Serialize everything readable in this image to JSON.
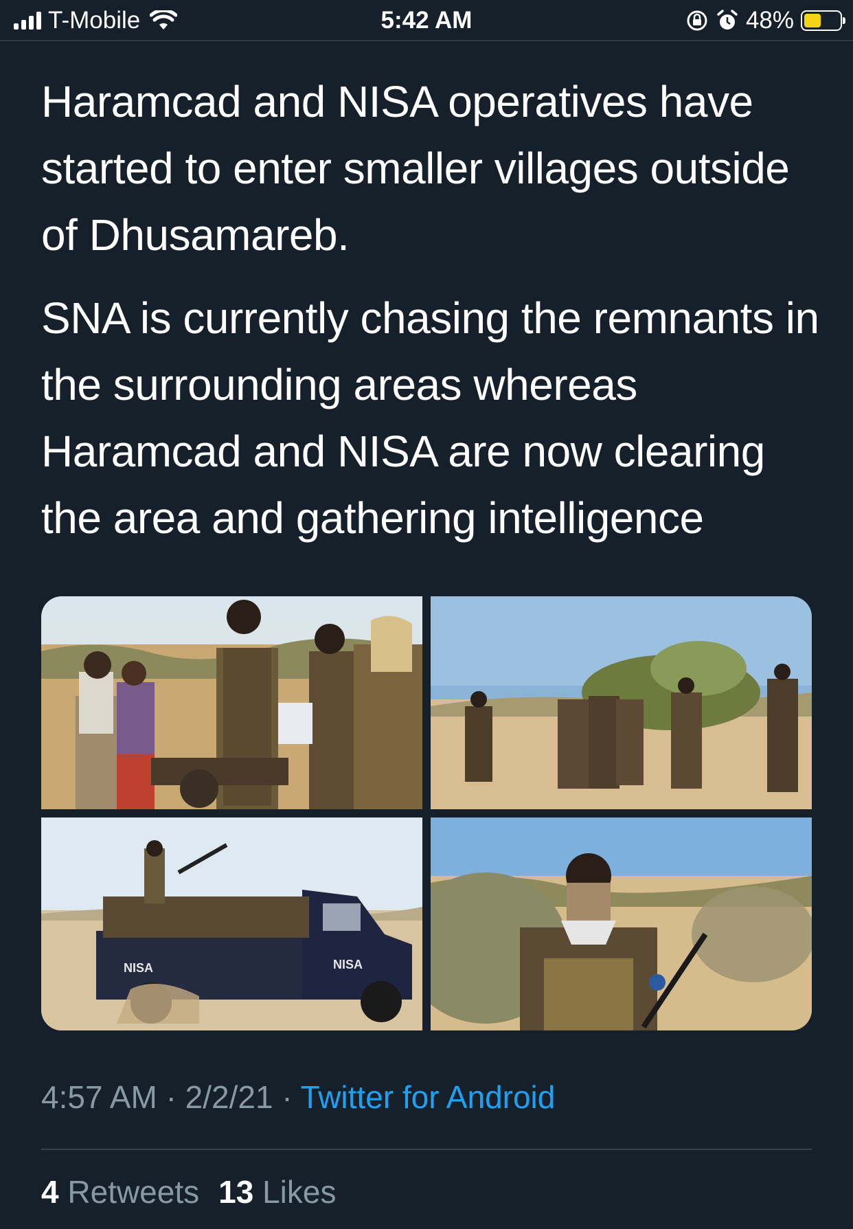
{
  "status_bar": {
    "carrier": "T-Mobile",
    "time": "5:42 AM",
    "battery_percent": "48%",
    "battery_level": 0.48,
    "icons": [
      "signal-icon",
      "wifi-icon",
      "orientation-lock-icon",
      "alarm-icon",
      "battery-icon"
    ]
  },
  "tweet": {
    "paragraphs": [
      "Haramcad and NISA operatives have started to enter smaller villages outside of Dhusamareb.",
      "SNA is currently chasing the remnants in the surrounding areas whereas Haramcad and NISA are now clearing the area and gathering intelligence"
    ],
    "media": [
      {
        "name": "photo-soldiers-with-villagers"
      },
      {
        "name": "photo-soldiers-patrolling"
      },
      {
        "name": "photo-nisa-pickup-truck",
        "labels": [
          "NISA",
          "NISA"
        ]
      },
      {
        "name": "photo-masked-soldier"
      }
    ],
    "timestamp": "4:57 AM",
    "separator": "·",
    "date": "2/2/21",
    "source": "Twitter for Android",
    "retweets_count": "4",
    "retweets_label": "Retweets",
    "likes_count": "13",
    "likes_label": "Likes"
  },
  "colors": {
    "background": "#15202b",
    "text": "#ffffff",
    "secondary": "#8899a6",
    "link": "#1da1f2",
    "battery": "#f5d315"
  }
}
